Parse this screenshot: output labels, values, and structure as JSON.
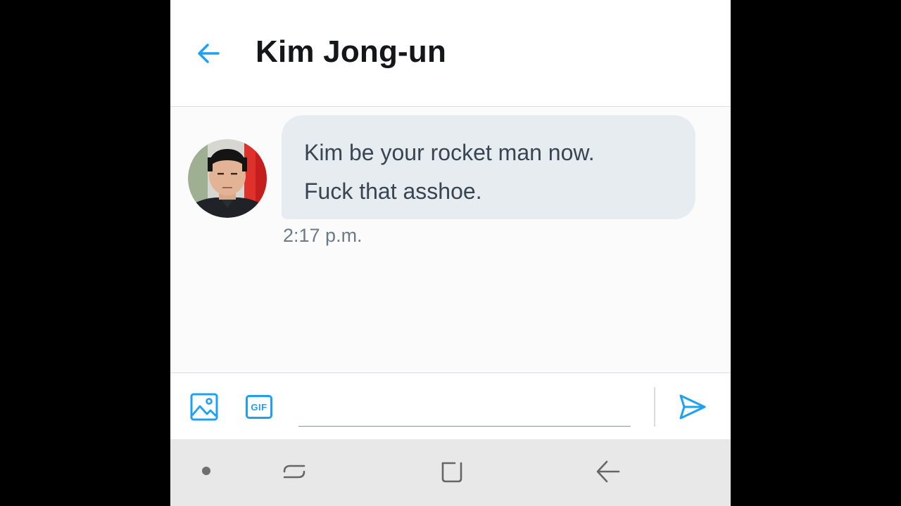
{
  "header": {
    "back_icon": "arrow-left-icon",
    "title": "Kim Jong-un"
  },
  "conversation": {
    "messages": [
      {
        "sender_avatar": "contact-avatar-photo",
        "text": "Kim be your rocket man now.\nFuck that asshoe.",
        "time": "2:17 p.m."
      }
    ]
  },
  "composer": {
    "media_icon": "image-icon",
    "gif_label": "GIF",
    "input_value": "",
    "input_placeholder": "",
    "send_icon": "send-icon"
  },
  "navbar": {
    "icons": [
      "dot-icon",
      "recents-icon",
      "home-icon",
      "back-icon"
    ]
  },
  "colors": {
    "accent": "#1da1f2",
    "bubble": "#e6ecf0",
    "title_text": "#14171a",
    "message_text": "#3b4451",
    "timestamp": "#6b7a89",
    "navbar_bg": "#e8e8e8"
  }
}
